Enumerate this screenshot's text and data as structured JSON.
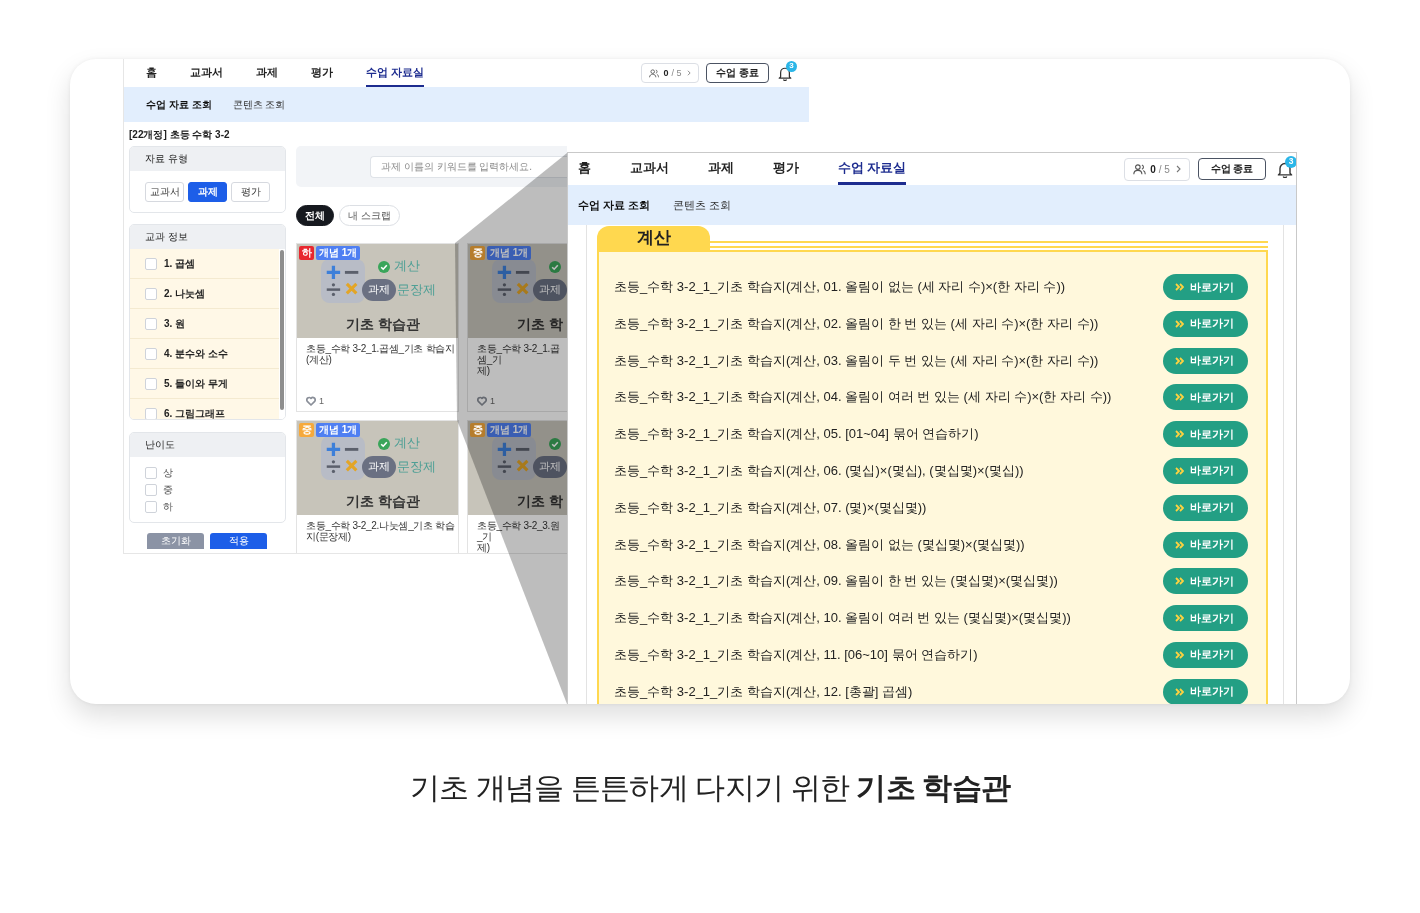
{
  "screen": {
    "header": {
      "nav": [
        {
          "label": "홈",
          "selected": false
        },
        {
          "label": "교과서",
          "selected": false
        },
        {
          "label": "과제",
          "selected": false
        },
        {
          "label": "평가",
          "selected": false
        },
        {
          "label": "수업 자료실",
          "selected": true
        }
      ],
      "user_counter": {
        "count": "0",
        "total": "/ 5"
      },
      "end_button": "수업 종료",
      "notifications": "3",
      "subnav": [
        {
          "label": "수업 자료 조회",
          "selected": true
        },
        {
          "label": "콘텐츠 조회",
          "selected": false
        }
      ]
    },
    "course_title": "[22개정] 초등 수학 3-2",
    "material_type": {
      "title": "자료 유형",
      "options": [
        {
          "label": "교과서",
          "selected": false
        },
        {
          "label": "과제",
          "selected": true
        },
        {
          "label": "평가",
          "selected": false
        }
      ]
    },
    "units": {
      "title": "교과 정보",
      "items": [
        {
          "label": "1. 곱셈",
          "checked": false
        },
        {
          "label": "2. 나눗셈",
          "checked": false
        },
        {
          "label": "3. 원",
          "checked": false
        },
        {
          "label": "4. 분수와 소수",
          "checked": false
        },
        {
          "label": "5. 들이와 무게",
          "checked": false
        },
        {
          "label": "6. 그림그래프",
          "checked": false
        }
      ]
    },
    "difficulty": {
      "title": "난이도",
      "items": [
        {
          "label": "상",
          "checked": false
        },
        {
          "label": "중",
          "checked": false
        },
        {
          "label": "하",
          "checked": false
        }
      ]
    },
    "reset_button": "초기화",
    "apply_button": "적용",
    "search": {
      "placeholder": "과제 이름의 키워드를 입력하세요."
    },
    "scope_chips": [
      {
        "label": "전체",
        "selected": true
      },
      {
        "label": "내 스크랩",
        "selected": false
      }
    ],
    "cards": [
      {
        "level": {
          "label": "하",
          "color": "#e8272f"
        },
        "concept": "개념 1개",
        "thumbnail": {
          "tag": "계산",
          "type": "과제",
          "subtitle": "문장제",
          "title": "기초 학습관"
        },
        "title": "초등_수학 3-2_1.곱셈_기초 학습지(계산)",
        "likes": "1"
      },
      {
        "level": {
          "label": "중",
          "color": "#b67d2c"
        },
        "concept": "개념 1개",
        "thumbnail": {
          "type": "과제",
          "title": "기초 학"
        },
        "title": "초등_수학 3-2_1.곱셈_기\n제)",
        "likes": "1"
      },
      {
        "level": {
          "label": "중",
          "color": "#f6a93b"
        },
        "concept": "개념 1개",
        "thumbnail": {
          "tag": "계산",
          "type": "과제",
          "subtitle": "문장제",
          "title": "기초 학습관"
        },
        "title": "초등_수학 3-2_2.나눗셈_기초 학습지(문장제)"
      },
      {
        "level": {
          "label": "중",
          "color": "#b67d2c"
        },
        "concept": "개념 1개",
        "thumbnail": {
          "type": "과제",
          "title": "기초 학"
        },
        "title": "초등_수학 3-2_3.원_기\n제)"
      }
    ]
  },
  "zoom_view": {
    "header": {
      "nav": [
        {
          "label": "홈",
          "selected": false
        },
        {
          "label": "교과서",
          "selected": false
        },
        {
          "label": "과제",
          "selected": false
        },
        {
          "label": "평가",
          "selected": false
        },
        {
          "label": "수업 자료실",
          "selected": true
        }
      ],
      "user_counter": {
        "count": "0",
        "total": "/ 5"
      },
      "end_button": "수업 종료",
      "notifications": "3",
      "subnav": [
        {
          "label": "수업 자료 조회",
          "selected": true
        },
        {
          "label": "콘텐츠 조회",
          "selected": false
        }
      ]
    },
    "section": {
      "title": "계산",
      "items": [
        {
          "title": "초등_수학 3-2_1_기초 학습지(계산, 01. 올림이 없는 (세 자리 수)×(한 자리 수))",
          "action": "바로가기"
        },
        {
          "title": "초등_수학 3-2_1_기초 학습지(계산, 02. 올림이 한 번 있는 (세 자리 수)×(한 자리 수))",
          "action": "바로가기"
        },
        {
          "title": "초등_수학 3-2_1_기초 학습지(계산, 03. 올림이 두 번 있는 (세 자리 수)×(한 자리 수))",
          "action": "바로가기"
        },
        {
          "title": "초등_수학 3-2_1_기초 학습지(계산, 04. 올림이 여러 번 있는 (세 자리 수)×(한 자리 수))",
          "action": "바로가기"
        },
        {
          "title": "초등_수학 3-2_1_기초 학습지(계산, 05. [01~04] 묶어 연습하기)",
          "action": "바로가기"
        },
        {
          "title": "초등_수학 3-2_1_기초 학습지(계산, 06. (몇십)×(몇십), (몇십몇)×(몇십))",
          "action": "바로가기"
        },
        {
          "title": "초등_수학 3-2_1_기초 학습지(계산, 07. (몇)×(몇십몇))",
          "action": "바로가기"
        },
        {
          "title": "초등_수학 3-2_1_기초 학습지(계산, 08. 올림이 없는 (몇십몇)×(몇십몇))",
          "action": "바로가기"
        },
        {
          "title": "초등_수학 3-2_1_기초 학습지(계산, 09. 올림이 한 번 있는 (몇십몇)×(몇십몇))",
          "action": "바로가기"
        },
        {
          "title": "초등_수학 3-2_1_기초 학습지(계산, 10. 올림이 여러 번 있는 (몇십몇)×(몇십몇))",
          "action": "바로가기"
        },
        {
          "title": "초등_수학 3-2_1_기초 학습지(계산, 11. [06~10] 묶어 연습하기)",
          "action": "바로가기"
        },
        {
          "title": "초등_수학 3-2_1_기초 학습지(계산, 12. [총괄] 곱셈)",
          "action": "바로가기"
        }
      ]
    }
  },
  "caption": "기초 개념을 튼튼하게 다지기 위한 **기초 학습관**"
}
